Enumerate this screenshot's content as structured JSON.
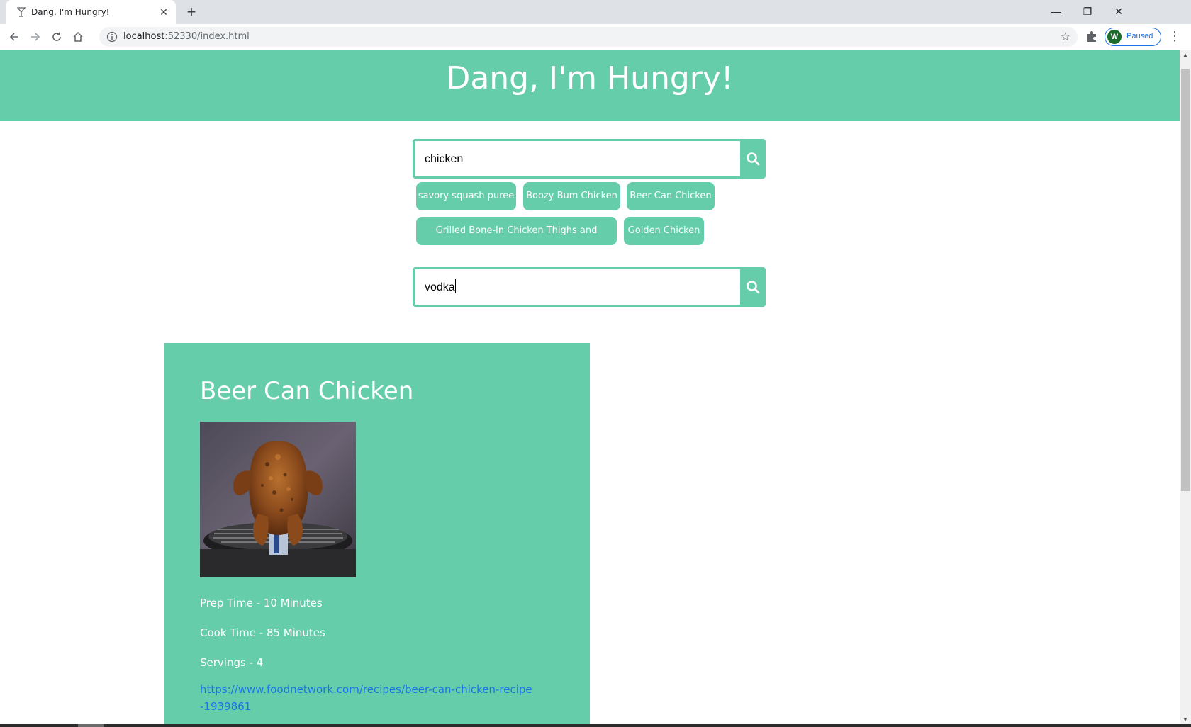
{
  "browser": {
    "tab_title": "Dang, I'm Hungry!",
    "url_host": "localhost",
    "url_rest": ":52330/index.html",
    "profile_initial": "W",
    "profile_status": "Paused"
  },
  "page": {
    "title": "Dang, I'm Hungry!",
    "food_search": {
      "value": "chicken"
    },
    "suggestions": [
      "savory squash puree",
      "Boozy Bum Chicken",
      "Beer Can Chicken",
      "Grilled Bone-In Chicken Thighs and Wingettes",
      "Golden Chicken"
    ],
    "drink_search": {
      "value": "vodka"
    },
    "recipe": {
      "title": "Beer Can Chicken",
      "prep_time": "Prep Time - 10 Minutes",
      "cook_time": "Cook Time - 85 Minutes",
      "servings": "Servings - 4",
      "link": "https://www.foodnetwork.com/recipes/beer-can-chicken-recipe-1939861"
    }
  },
  "colors": {
    "accent": "#66cdaa",
    "link": "#1a73e8"
  },
  "icons": {
    "search": "search-icon",
    "favicon": "cocktail-icon"
  }
}
